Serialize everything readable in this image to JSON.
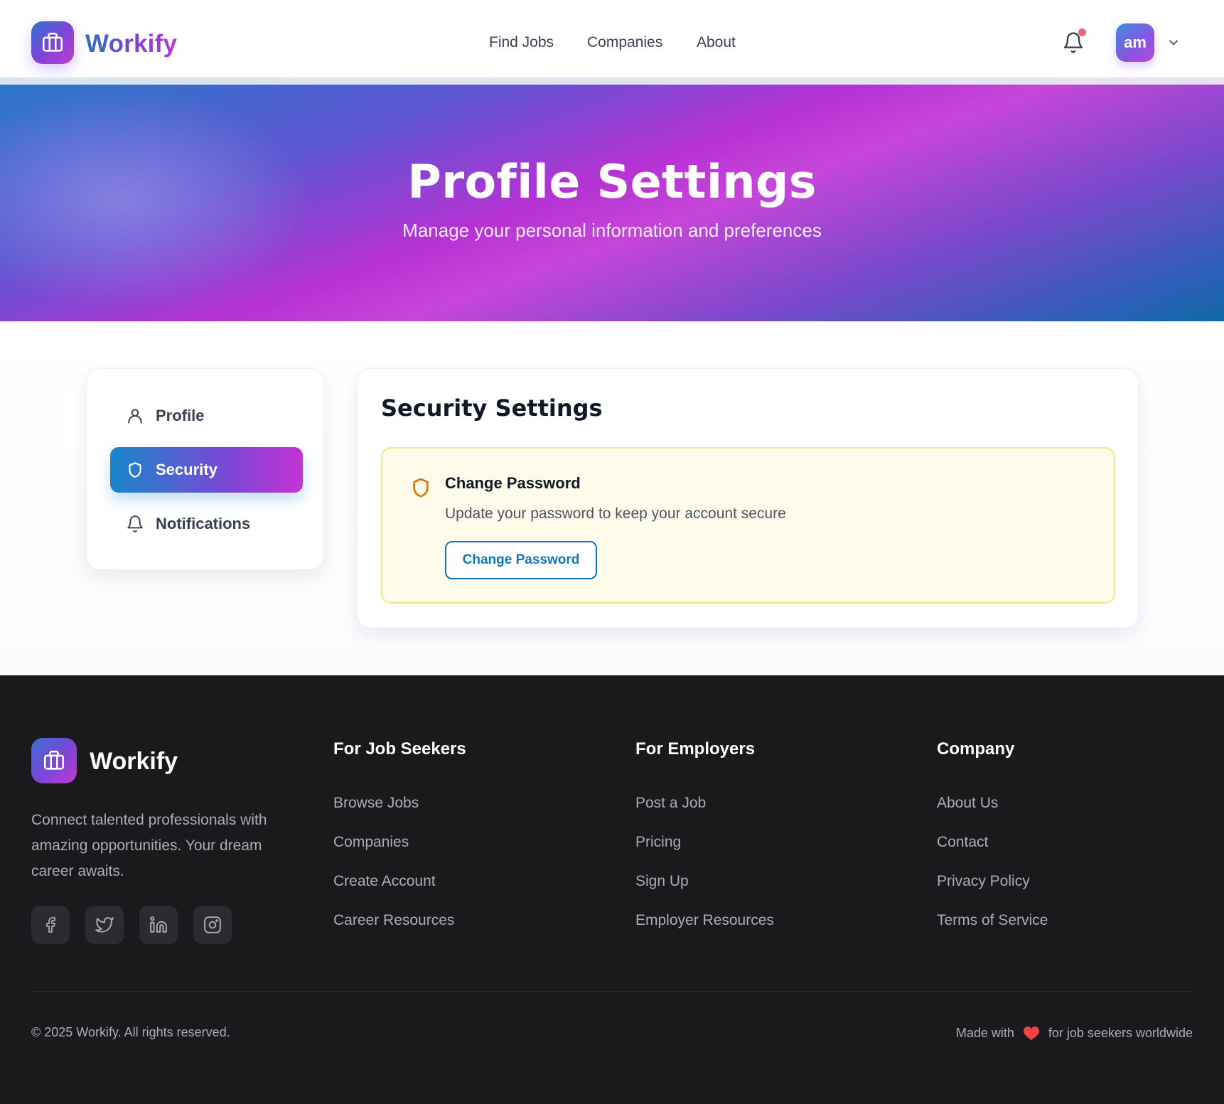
{
  "header": {
    "brand": "Workify",
    "nav": [
      "Find Jobs",
      "Companies",
      "About"
    ],
    "avatar_initials": "am",
    "notification_dot": true
  },
  "hero": {
    "title": "Profile Settings",
    "subtitle": "Manage your personal information and preferences"
  },
  "sidebar": {
    "items": [
      {
        "label": "Profile",
        "icon": "user-icon",
        "active": false
      },
      {
        "label": "Security",
        "icon": "shield-icon",
        "active": true
      },
      {
        "label": "Notifications",
        "icon": "bell-icon",
        "active": false
      }
    ]
  },
  "security": {
    "title": "Security Settings",
    "change_password": {
      "title": "Change Password",
      "description": "Update your password to keep your account secure",
      "button": "Change Password"
    }
  },
  "footer": {
    "brand": "Workify",
    "description": "Connect talented professionals with amazing opportunities. Your dream career awaits.",
    "social": [
      "facebook-icon",
      "twitter-icon",
      "linkedin-icon",
      "instagram-icon"
    ],
    "columns": [
      {
        "heading": "For Job Seekers",
        "links": [
          "Browse Jobs",
          "Companies",
          "Create Account",
          "Career Resources"
        ]
      },
      {
        "heading": "For Employers",
        "links": [
          "Post a Job",
          "Pricing",
          "Sign Up",
          "Employer Resources"
        ]
      },
      {
        "heading": "Company",
        "links": [
          "About Us",
          "Contact",
          "Privacy Policy",
          "Terms of Service"
        ]
      }
    ],
    "copyright": "© 2025 Workify. All rights reserved.",
    "made_with_prefix": "Made with",
    "made_with_suffix": "for job seekers worldwide"
  },
  "colors": {
    "accent_blue": "#1787c9",
    "accent_purple": "#7a48d6",
    "accent_magenta": "#c332d4",
    "warning_bg": "#fefbea",
    "warning_border": "#f6e38a",
    "warning_icon": "#d97706",
    "heart": "#ef4444",
    "footer_bg": "#1a1a1d"
  }
}
